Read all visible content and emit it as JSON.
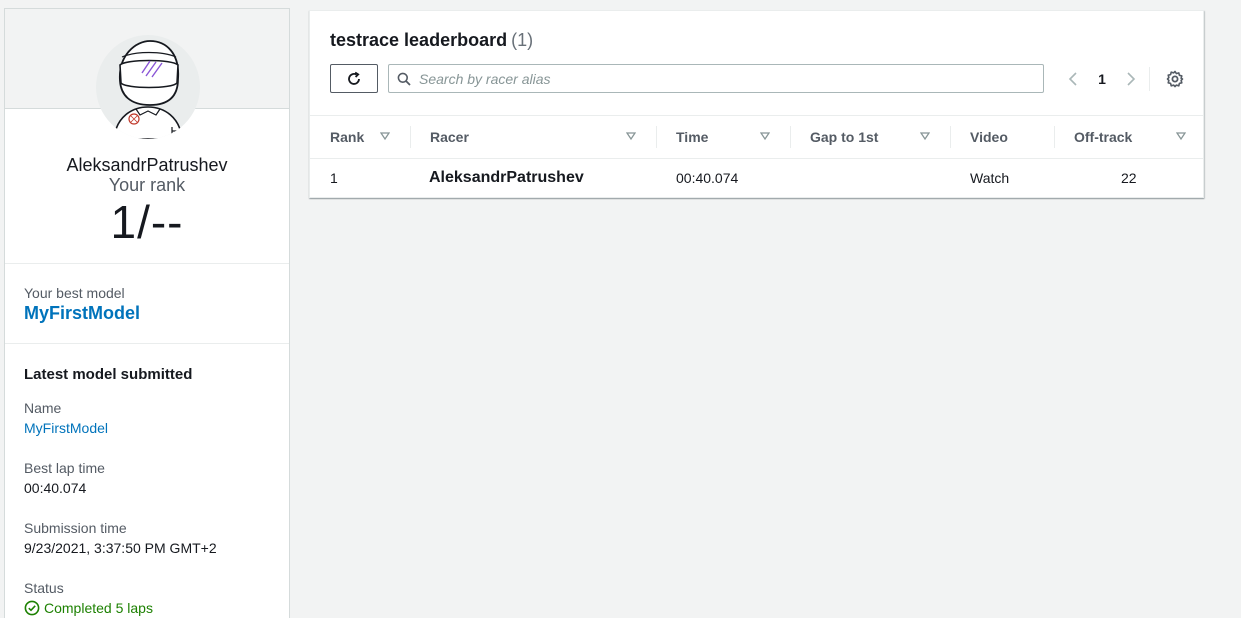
{
  "profile": {
    "racer_name": "AleksandrPatrushev",
    "rank_label": "Your rank",
    "rank_value": "1/--",
    "best_model_label": "Your best model",
    "best_model_name": "MyFirstModel",
    "latest_section_title": "Latest model submitted",
    "name_label": "Name",
    "name_value": "MyFirstModel",
    "best_lap_label": "Best lap time",
    "best_lap_value": "00:40.074",
    "submission_label": "Submission time",
    "submission_value": "9/23/2021, 3:37:50 PM GMT+2",
    "status_label": "Status",
    "status_value": "Completed 5 laps",
    "status_color": "#1d8102"
  },
  "leaderboard": {
    "title": "testrace leaderboard",
    "count": "(1)",
    "search_placeholder": "Search by racer alias",
    "current_page": "1",
    "columns": [
      "Rank",
      "Racer",
      "Time",
      "Gap to 1st",
      "Video",
      "Off-track"
    ],
    "rows": [
      {
        "rank": "1",
        "racer": "AleksandrPatrushev",
        "time": "00:40.074",
        "gap": "",
        "video": "Watch",
        "off_track": "22"
      }
    ]
  },
  "icons": {
    "refresh": "refresh-icon",
    "search": "search-icon",
    "prev": "chevron-left-icon",
    "next": "chevron-right-icon",
    "settings": "gear-icon",
    "sort": "caret-down-icon",
    "status": "check-circle-icon"
  },
  "colors": {
    "link": "#0073bb",
    "background": "#f2f3f3"
  }
}
